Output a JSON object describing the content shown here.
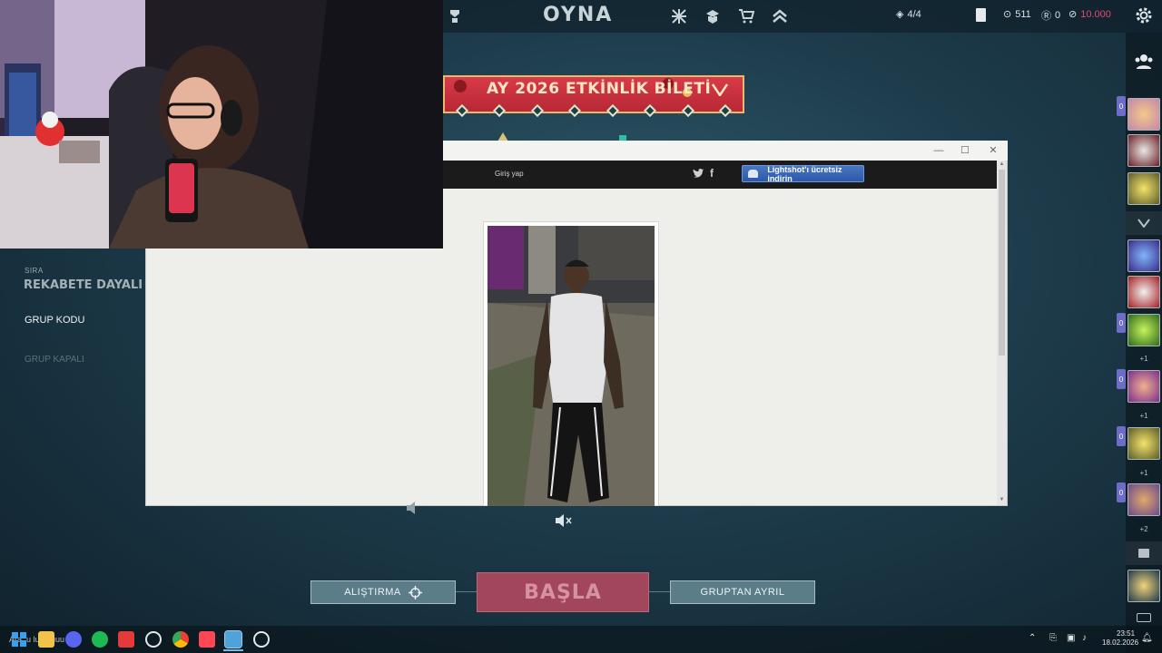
{
  "topbar": {
    "title": "OYNA",
    "party_count": "4/4",
    "kingdom_credits": "511",
    "radianite": "0",
    "valorant_points": "10.000"
  },
  "banner": {
    "text": "AY 2026 ETKİNLİK BİLETİ"
  },
  "left_panel": {
    "queue_label": "SIRA",
    "queue_value": "REKABETE DAYALI",
    "group_code": "GRUP KODU",
    "group_closed": "GRUP KAPALI"
  },
  "roster": {
    "plus_labels": [
      "+1",
      "+1",
      "+1",
      "+2"
    ],
    "badge_label": "0"
  },
  "lightshot": {
    "login": "Giriş yap",
    "download_button": "Lightshot'ı ücretsiz indirin"
  },
  "bottom": {
    "practice": "ALIŞTIRMA",
    "start": "BAŞLA",
    "leave": "GRUPTAN AYRIL"
  },
  "taskbar": {
    "search_partial": "Ara: u  luuu  uuu",
    "time": "23:51",
    "date": "18.02.2026"
  },
  "colors": {
    "accent_red": "#a1465b",
    "vp_pink": "#e24a6c",
    "button_teal": "#5b7d8a",
    "lightshot_blue": "#2b59a7"
  }
}
